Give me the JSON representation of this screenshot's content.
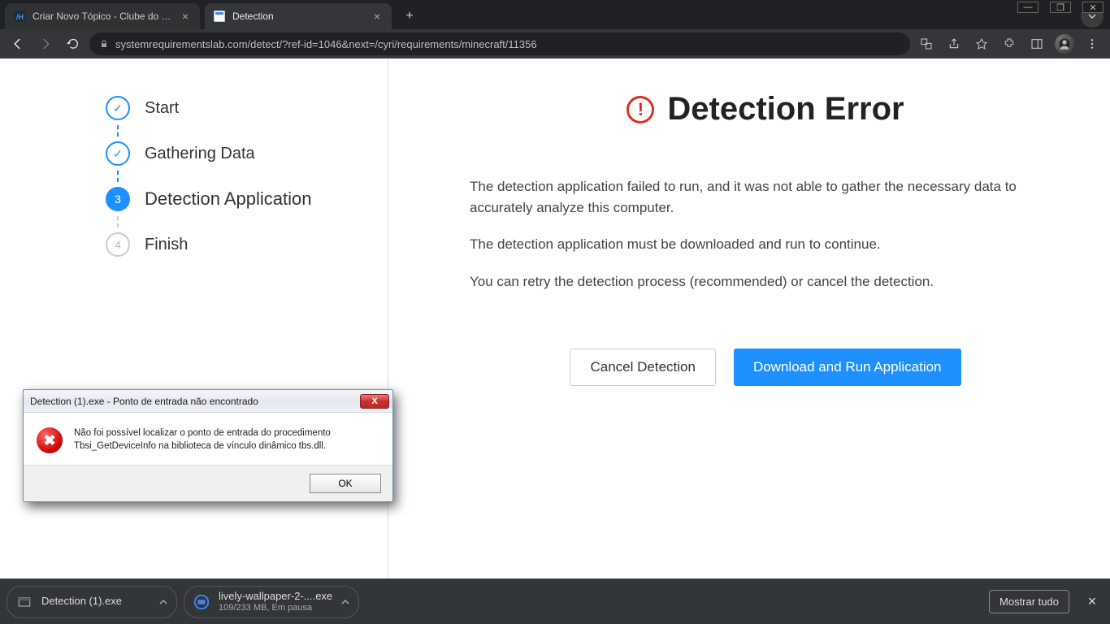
{
  "browser": {
    "tabs": [
      {
        "title": "Criar Novo Tópico - Clube do Ha",
        "active": false
      },
      {
        "title": "Detection",
        "active": true
      }
    ],
    "url": "systemrequirementslab.com/detect/?ref-id=1046&next=/cyri/requirements/minecraft/11356"
  },
  "sidebar": {
    "steps": [
      {
        "label": "Start",
        "state": "done"
      },
      {
        "label": "Gathering Data",
        "state": "done"
      },
      {
        "label": "Detection Application",
        "state": "current",
        "num": "3"
      },
      {
        "label": "Finish",
        "state": "pending",
        "num": "4"
      }
    ]
  },
  "main": {
    "heading": "Detection Error",
    "paragraphs": [
      "The detection application failed to run, and it was not able to gather the necessary data to accurately analyze this computer.",
      "The detection application must be downloaded and run to continue.",
      "You can retry the detection process (recommended) or cancel the detection."
    ],
    "buttons": {
      "cancel": "Cancel Detection",
      "download": "Download and Run Application"
    }
  },
  "dialog": {
    "title": "Detection (1).exe - Ponto de entrada não encontrado",
    "message": "Não foi possível localizar o ponto de entrada do procedimento Tbsi_GetDeviceInfo na biblioteca de vínculo dinâmico tbs.dll.",
    "ok": "OK"
  },
  "download_shelf": {
    "items": [
      {
        "name": "Detection (1).exe",
        "sub": ""
      },
      {
        "name": "lively-wallpaper-2-....exe",
        "sub": "109/233 MB, Em pausa"
      }
    ],
    "show_all": "Mostrar tudo"
  }
}
